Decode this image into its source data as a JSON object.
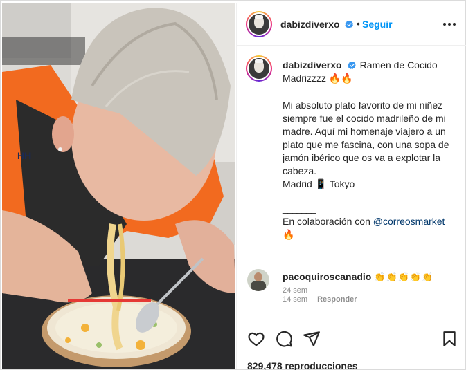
{
  "post": {
    "author": "dabizdiverxo",
    "follow_label": "Seguir",
    "separator_dot": "•",
    "caption": {
      "title": "Ramen de Cocido Madrizzzz 🔥🔥",
      "body": "Mi absoluto plato favorito de mi niñez siempre fue el cocido madrileño de mi madre. Aquí mi homenaje viajero a un plato que me fascina, con una sopa de jamón ibérico que os va a explotar la cabeza.",
      "route": "Madrid 📱 Tokyo",
      "separator": "_______",
      "collab_prefix": "En colaboración con ",
      "collab_mention": "@correosmarket",
      "collab_emoji": "🔥"
    },
    "timestamp": "24 sem",
    "comment": {
      "author": "pacoquiroscanadio",
      "emojis": "👏👏👏👏👏",
      "timestamp": "14 sem",
      "reply_label": "Responder"
    },
    "views": "829,478 reproducciones"
  },
  "icons": {
    "verified": "verified-badge-icon",
    "more": "more-options-icon",
    "like": "heart-icon",
    "comment": "comment-bubble-icon",
    "share": "paper-plane-icon",
    "save": "bookmark-icon"
  },
  "colors": {
    "accent": "#0095f6",
    "mention": "#00376b",
    "muted": "#8e8e8e",
    "text": "#262626"
  }
}
